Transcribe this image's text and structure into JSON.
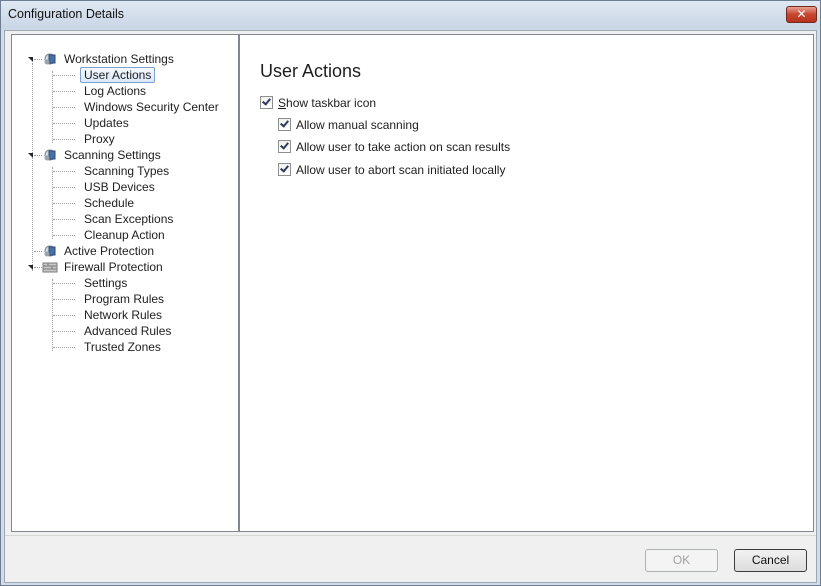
{
  "window": {
    "title": "Configuration Details",
    "close_symbol": "✕"
  },
  "tree": {
    "groups": [
      {
        "label": "Workstation Settings",
        "icon": "workstation-settings-icon",
        "children": [
          "User Actions",
          "Log Actions",
          "Windows Security Center",
          "Updates",
          "Proxy"
        ]
      },
      {
        "label": "Scanning Settings",
        "icon": "scanning-settings-icon",
        "children": [
          "Scanning Types",
          "USB Devices",
          "Schedule",
          "Scan Exceptions",
          "Cleanup Action"
        ]
      },
      {
        "label": "Active Protection",
        "icon": "active-protection-icon",
        "children": []
      },
      {
        "label": "Firewall Protection",
        "icon": "firewall-protection-icon",
        "children": [
          "Settings",
          "Program Rules",
          "Network Rules",
          "Advanced Rules",
          "Trusted Zones"
        ]
      }
    ],
    "selected": "User Actions"
  },
  "content": {
    "heading": "User Actions",
    "show_taskbar": {
      "accel": "S",
      "rest": "how taskbar icon",
      "checked": true
    },
    "options": [
      {
        "label": "Allow manual scanning",
        "checked": true
      },
      {
        "label": "Allow user to take action on scan results",
        "checked": true
      },
      {
        "label": "Allow user to abort scan initiated locally",
        "checked": true
      }
    ]
  },
  "buttons": {
    "ok": "OK",
    "cancel": "Cancel"
  }
}
